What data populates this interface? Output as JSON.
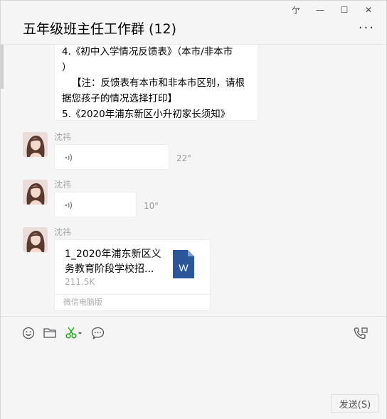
{
  "window_controls": {
    "pin": "亇",
    "minimize": "—",
    "maximize": "☐",
    "close": "✕"
  },
  "header": {
    "title": "五年级班主任工作群 (12)",
    "more": "···"
  },
  "messages": {
    "text_lines": [
      "4.《初中入学情况反馈表》（本市/非本市",
      "）",
      "【注：反馈表有本市和非本市区别，请根",
      "据您孩子的情况选择打印】",
      "5.《2020年浦东新区小升初家长须知》"
    ],
    "voice1": {
      "sender": "沈祎",
      "duration": "22\""
    },
    "voice2": {
      "sender": "沈祎",
      "duration": "10\""
    },
    "file": {
      "sender": "沈祎",
      "name_line1": "1_2020年浦东新区义",
      "name_line2": "务教育阶段学校招...",
      "size": "211.5K",
      "source": "微信电脑版",
      "icon_letter": "W"
    }
  },
  "toolbar": {
    "emoji_icon": "emoji-icon",
    "folder_icon": "folder-icon",
    "scissors_icon": "scissors-icon",
    "chat_icon": "chat-history-icon",
    "call_icon": "phone-call-icon"
  },
  "input": {
    "send_label": "发送(S)"
  },
  "colors": {
    "accent_green": "#1aad19",
    "word_blue": "#2b579a",
    "background": "#f5f5f5"
  }
}
